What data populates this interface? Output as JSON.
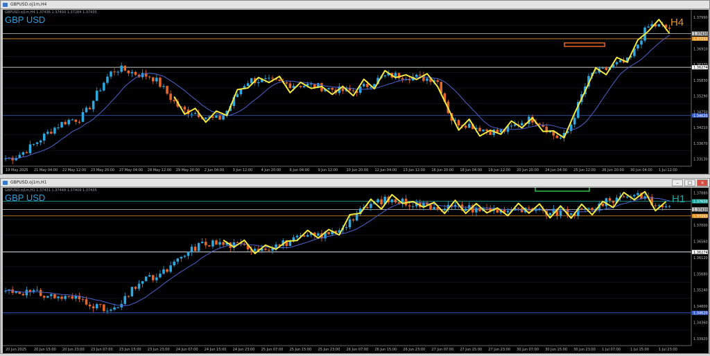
{
  "h4": {
    "title": "GBPUSD.oj1m,H4",
    "symbol": "GBP USD",
    "timeframe": "H4",
    "tf_color": "#e8962a",
    "ohlc": "GBPUSD.oj1m,H4  1.37436 1.37493 1.37284 1.37435",
    "price_min": 1.3288,
    "price_max": 1.3825,
    "price_ticks": [
      "1.37990",
      "1.37450",
      "1.36910",
      "1.36370",
      "1.35830",
      "1.35290",
      "1.34750",
      "1.34210",
      "1.33670",
      "1.33130"
    ],
    "tagged": [
      {
        "label": "1.37430",
        "price": 1.3743,
        "color": "#c8c8c8"
      },
      {
        "label": "1.37253",
        "price": 1.37253,
        "color": "#e8962a"
      },
      {
        "label": "1.36274",
        "price": 1.36274,
        "color": "#ffffff"
      },
      {
        "label": "1.34620",
        "price": 1.3462,
        "color": "#3a5fcf"
      }
    ],
    "time_ticks": [
      "19 May 2025",
      "21 May 04:00",
      "22 May 12:00",
      "23 May 20:00",
      "27 May 04:00",
      "28 May 12:00",
      "29 May 20:00",
      "2 Jun 04:00",
      "3 Jun 12:00",
      "4 Jun 20:00",
      "6 Jun 04:00",
      "9 Jun 12:00",
      "10 Jun 20:00",
      "12 Jun 04:00",
      "13 Jun 12:00",
      "16 Jun 20:00",
      "18 Jun 04:00",
      "19 Jun 12:00",
      "20 Jun 20:00",
      "24 Jun 04:00",
      "25 Jun 12:00",
      "26 Jun 20:00",
      "30 Jun 04:00",
      "1 Jul 12:00"
    ]
  },
  "h1": {
    "title": "GBPUSD.oj1m,H1",
    "symbol": "GBP USD",
    "timeframe": "H1",
    "tf_color": "#20a8a0",
    "ohlc": "GBPUSD.oj1m,H1  1.37431 1.37448 1.37409 1.37435",
    "price_min": 1.3373,
    "price_max": 1.3802,
    "price_ticks": [
      "1.37880",
      "1.37440",
      "1.37000",
      "1.36560",
      "1.36120",
      "1.35680",
      "1.35240",
      "1.34800",
      "1.34360",
      "1.33920"
    ],
    "tagged": [
      {
        "label": "1.37650",
        "price": 1.3765,
        "color": "#20a8a0"
      },
      {
        "label": "1.37430",
        "price": 1.3743,
        "color": "#c8c8c8"
      },
      {
        "label": "1.37253",
        "price": 1.37253,
        "color": "#e8962a"
      },
      {
        "label": "1.36274",
        "price": 1.36274,
        "color": "#ffffff"
      },
      {
        "label": "1.34620",
        "price": 1.3462,
        "color": "#3a5fcf"
      }
    ],
    "time_ticks": [
      "20 Jun 2025",
      "20 Jun 15:00",
      "20 Jun 23:00",
      "23 Jun 07:00",
      "23 Jun 15:00",
      "23 Jun 23:00",
      "24 Jun 07:00",
      "24 Jun 15:00",
      "24 Jun 23:00",
      "25 Jun 07:00",
      "25 Jun 15:00",
      "25 Jun 23:00",
      "26 Jun 07:00",
      "26 Jun 15:00",
      "26 Jun 23:00",
      "27 Jun 07:00",
      "27 Jun 15:00",
      "27 Jun 23:00",
      "30 Jun 07:00",
      "30 Jun 15:00",
      "30 Jun 23:00",
      "1 Jul 07:00",
      "1 Jul 15:00",
      "1 Jul 23:00"
    ]
  },
  "window_buttons": {
    "minimize": "–",
    "maximize": "□",
    "close": "×"
  },
  "colors": {
    "bull": "#2fa8e0",
    "bear": "#e8662a",
    "zigzag": "#f4e842",
    "ma": "#4a62d0",
    "grid": "#1b2630"
  }
}
